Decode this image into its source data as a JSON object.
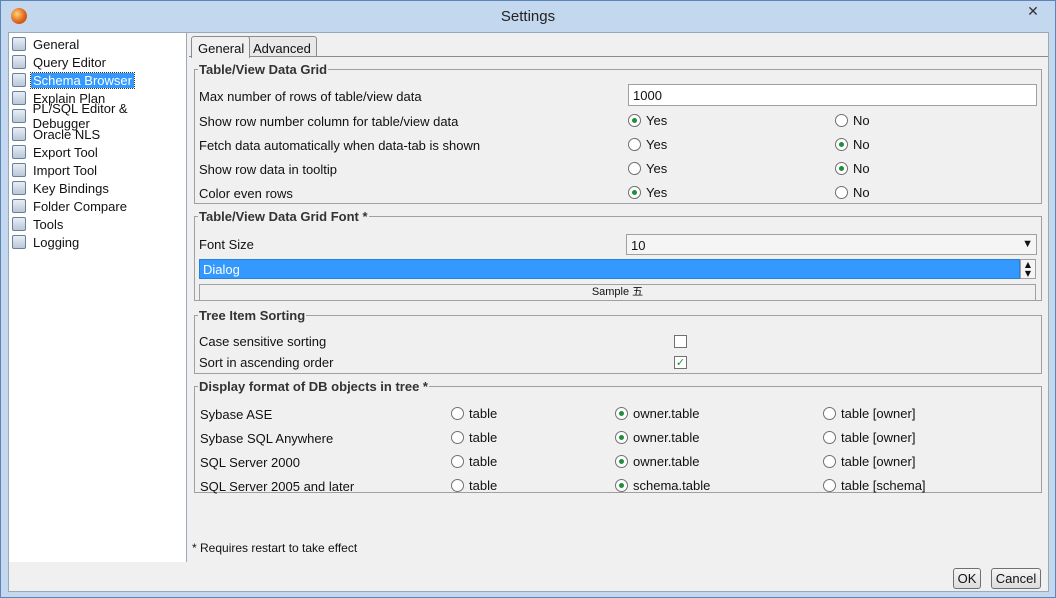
{
  "window": {
    "title": "Settings",
    "close": "✕"
  },
  "sidebar": {
    "items": [
      {
        "label": "General"
      },
      {
        "label": "Query Editor"
      },
      {
        "label": "Schema Browser"
      },
      {
        "label": "Explain Plan"
      },
      {
        "label": "PL/SQL Editor & Debugger"
      },
      {
        "label": "Oracle NLS"
      },
      {
        "label": "Export Tool"
      },
      {
        "label": "Import Tool"
      },
      {
        "label": "Key Bindings"
      },
      {
        "label": "Folder Compare"
      },
      {
        "label": "Tools"
      },
      {
        "label": "Logging"
      }
    ],
    "selected": "Schema Browser"
  },
  "tabs": [
    {
      "label": "General"
    },
    {
      "label": "Advanced"
    }
  ],
  "grid": {
    "title": "Table/View Data Grid",
    "max_rows_label": "Max number of rows of table/view data",
    "max_rows_value": "1000",
    "rows": [
      {
        "label": "Show row number column for table/view data",
        "yes": "Yes",
        "no": "No",
        "selected": "yes"
      },
      {
        "label": "Fetch data automatically when data-tab is shown",
        "yes": "Yes",
        "no": "No",
        "selected": "no"
      },
      {
        "label": "Show row data in tooltip",
        "yes": "Yes",
        "no": "No",
        "selected": "no"
      },
      {
        "label": "Color even rows",
        "yes": "Yes",
        "no": "No",
        "selected": "yes"
      }
    ]
  },
  "font": {
    "title": "Table/View Data Grid Font *",
    "size_label": "Font Size",
    "size_value": "10",
    "family_value": "Dialog",
    "sample": "Sample 五"
  },
  "sorting": {
    "title": "Tree Item Sorting",
    "case_label": "Case sensitive sorting",
    "case_checked": false,
    "asc_label": "Sort in ascending order",
    "asc_checked": true
  },
  "display": {
    "title": "Display format of DB objects in tree *",
    "rows": [
      {
        "label": "Sybase ASE",
        "o1": "table",
        "o2": "owner.table",
        "o3": "table [owner]",
        "selected": 2
      },
      {
        "label": "Sybase SQL Anywhere",
        "o1": "table",
        "o2": "owner.table",
        "o3": "table [owner]",
        "selected": 2
      },
      {
        "label": "SQL Server 2000",
        "o1": "table",
        "o2": "owner.table",
        "o3": "table [owner]",
        "selected": 2
      },
      {
        "label": "SQL Server 2005 and later",
        "o1": "table",
        "o2": "schema.table",
        "o3": "table [schema]",
        "selected": 2
      }
    ]
  },
  "footnote": "* Requires restart to take effect",
  "buttons": {
    "ok": "OK",
    "cancel": "Cancel"
  }
}
